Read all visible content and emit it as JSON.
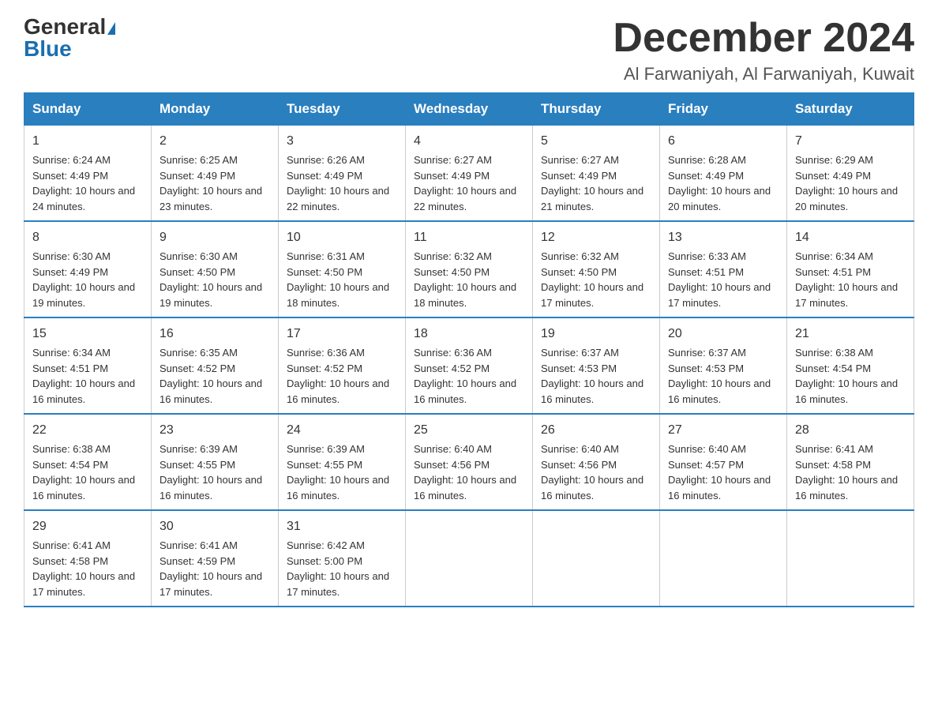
{
  "header": {
    "logo_general": "General",
    "logo_blue": "Blue",
    "month_title": "December 2024",
    "location": "Al Farwaniyah, Al Farwaniyah, Kuwait"
  },
  "weekdays": [
    "Sunday",
    "Monday",
    "Tuesday",
    "Wednesday",
    "Thursday",
    "Friday",
    "Saturday"
  ],
  "weeks": [
    [
      {
        "day": "1",
        "sunrise": "6:24 AM",
        "sunset": "4:49 PM",
        "daylight": "10 hours and 24 minutes."
      },
      {
        "day": "2",
        "sunrise": "6:25 AM",
        "sunset": "4:49 PM",
        "daylight": "10 hours and 23 minutes."
      },
      {
        "day": "3",
        "sunrise": "6:26 AM",
        "sunset": "4:49 PM",
        "daylight": "10 hours and 22 minutes."
      },
      {
        "day": "4",
        "sunrise": "6:27 AM",
        "sunset": "4:49 PM",
        "daylight": "10 hours and 22 minutes."
      },
      {
        "day": "5",
        "sunrise": "6:27 AM",
        "sunset": "4:49 PM",
        "daylight": "10 hours and 21 minutes."
      },
      {
        "day": "6",
        "sunrise": "6:28 AM",
        "sunset": "4:49 PM",
        "daylight": "10 hours and 20 minutes."
      },
      {
        "day": "7",
        "sunrise": "6:29 AM",
        "sunset": "4:49 PM",
        "daylight": "10 hours and 20 minutes."
      }
    ],
    [
      {
        "day": "8",
        "sunrise": "6:30 AM",
        "sunset": "4:49 PM",
        "daylight": "10 hours and 19 minutes."
      },
      {
        "day": "9",
        "sunrise": "6:30 AM",
        "sunset": "4:50 PM",
        "daylight": "10 hours and 19 minutes."
      },
      {
        "day": "10",
        "sunrise": "6:31 AM",
        "sunset": "4:50 PM",
        "daylight": "10 hours and 18 minutes."
      },
      {
        "day": "11",
        "sunrise": "6:32 AM",
        "sunset": "4:50 PM",
        "daylight": "10 hours and 18 minutes."
      },
      {
        "day": "12",
        "sunrise": "6:32 AM",
        "sunset": "4:50 PM",
        "daylight": "10 hours and 17 minutes."
      },
      {
        "day": "13",
        "sunrise": "6:33 AM",
        "sunset": "4:51 PM",
        "daylight": "10 hours and 17 minutes."
      },
      {
        "day": "14",
        "sunrise": "6:34 AM",
        "sunset": "4:51 PM",
        "daylight": "10 hours and 17 minutes."
      }
    ],
    [
      {
        "day": "15",
        "sunrise": "6:34 AM",
        "sunset": "4:51 PM",
        "daylight": "10 hours and 16 minutes."
      },
      {
        "day": "16",
        "sunrise": "6:35 AM",
        "sunset": "4:52 PM",
        "daylight": "10 hours and 16 minutes."
      },
      {
        "day": "17",
        "sunrise": "6:36 AM",
        "sunset": "4:52 PM",
        "daylight": "10 hours and 16 minutes."
      },
      {
        "day": "18",
        "sunrise": "6:36 AM",
        "sunset": "4:52 PM",
        "daylight": "10 hours and 16 minutes."
      },
      {
        "day": "19",
        "sunrise": "6:37 AM",
        "sunset": "4:53 PM",
        "daylight": "10 hours and 16 minutes."
      },
      {
        "day": "20",
        "sunrise": "6:37 AM",
        "sunset": "4:53 PM",
        "daylight": "10 hours and 16 minutes."
      },
      {
        "day": "21",
        "sunrise": "6:38 AM",
        "sunset": "4:54 PM",
        "daylight": "10 hours and 16 minutes."
      }
    ],
    [
      {
        "day": "22",
        "sunrise": "6:38 AM",
        "sunset": "4:54 PM",
        "daylight": "10 hours and 16 minutes."
      },
      {
        "day": "23",
        "sunrise": "6:39 AM",
        "sunset": "4:55 PM",
        "daylight": "10 hours and 16 minutes."
      },
      {
        "day": "24",
        "sunrise": "6:39 AM",
        "sunset": "4:55 PM",
        "daylight": "10 hours and 16 minutes."
      },
      {
        "day": "25",
        "sunrise": "6:40 AM",
        "sunset": "4:56 PM",
        "daylight": "10 hours and 16 minutes."
      },
      {
        "day": "26",
        "sunrise": "6:40 AM",
        "sunset": "4:56 PM",
        "daylight": "10 hours and 16 minutes."
      },
      {
        "day": "27",
        "sunrise": "6:40 AM",
        "sunset": "4:57 PM",
        "daylight": "10 hours and 16 minutes."
      },
      {
        "day": "28",
        "sunrise": "6:41 AM",
        "sunset": "4:58 PM",
        "daylight": "10 hours and 16 minutes."
      }
    ],
    [
      {
        "day": "29",
        "sunrise": "6:41 AM",
        "sunset": "4:58 PM",
        "daylight": "10 hours and 17 minutes."
      },
      {
        "day": "30",
        "sunrise": "6:41 AM",
        "sunset": "4:59 PM",
        "daylight": "10 hours and 17 minutes."
      },
      {
        "day": "31",
        "sunrise": "6:42 AM",
        "sunset": "5:00 PM",
        "daylight": "10 hours and 17 minutes."
      },
      null,
      null,
      null,
      null
    ]
  ],
  "labels": {
    "sunrise": "Sunrise: ",
    "sunset": "Sunset: ",
    "daylight": "Daylight: "
  }
}
